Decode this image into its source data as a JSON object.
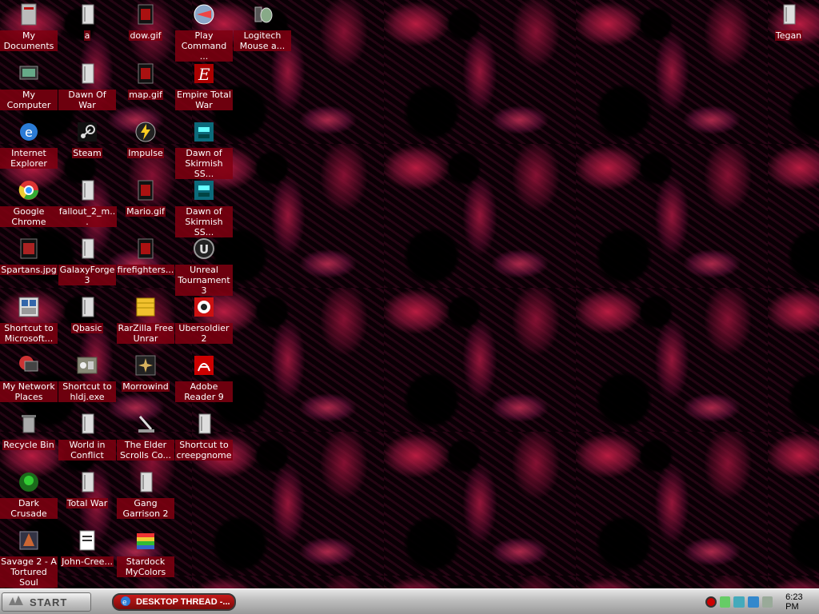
{
  "desktop": {
    "icons": [
      {
        "label": "My Documents",
        "icon": "folder-documents-icon"
      },
      {
        "label": "My Computer",
        "icon": "computer-icon"
      },
      {
        "label": "Internet Explorer",
        "icon": "ie-icon"
      },
      {
        "label": "Google Chrome",
        "icon": "chrome-icon"
      },
      {
        "label": "Spartans.jpg",
        "icon": "image-file-icon"
      },
      {
        "label": "Shortcut to Microsoft...",
        "icon": "app-shortcut-icon"
      },
      {
        "label": "My Network Places",
        "icon": "network-icon"
      },
      {
        "label": "Recycle Bin",
        "icon": "recycle-bin-icon"
      },
      {
        "label": "Dark Crusade",
        "icon": "game-icon"
      },
      {
        "label": "Savage 2 - A Tortured Soul",
        "icon": "game-icon"
      },
      {
        "label": "a",
        "icon": "folder-icon"
      },
      {
        "label": "Dawn Of War",
        "icon": "folder-icon"
      },
      {
        "label": "Steam",
        "icon": "steam-icon"
      },
      {
        "label": "fallout_2_m...",
        "icon": "folder-icon"
      },
      {
        "label": "GalaxyForge 3",
        "icon": "folder-icon"
      },
      {
        "label": "Qbasic",
        "icon": "folder-icon"
      },
      {
        "label": "Shortcut to hldj.exe",
        "icon": "app-shortcut-icon"
      },
      {
        "label": "World in Conflict",
        "icon": "folder-icon"
      },
      {
        "label": "Total War",
        "icon": "folder-icon"
      },
      {
        "label": "John-Cree...",
        "icon": "text-file-icon"
      },
      {
        "label": "dow.gif",
        "icon": "image-file-icon"
      },
      {
        "label": "map.gif",
        "icon": "image-file-icon"
      },
      {
        "label": "Impulse",
        "icon": "impulse-icon"
      },
      {
        "label": "Mario.gif",
        "icon": "image-file-icon"
      },
      {
        "label": "firefighters...",
        "icon": "image-file-icon"
      },
      {
        "label": "RarZilla Free Unrar",
        "icon": "archive-icon"
      },
      {
        "label": "Morrowind",
        "icon": "game-icon"
      },
      {
        "label": "The Elder Scrolls Co...",
        "icon": "tool-icon"
      },
      {
        "label": "Gang Garrison 2",
        "icon": "folder-icon"
      },
      {
        "label": "Stardock MyColors",
        "icon": "stardock-icon"
      },
      {
        "label": "Play Command ...",
        "icon": "game-icon"
      },
      {
        "label": "Empire Total War",
        "icon": "game-icon"
      },
      {
        "label": "Dawn of Skirmish SS...",
        "icon": "game-icon"
      },
      {
        "label": "Dawn of Skirmish SS...",
        "icon": "game-icon"
      },
      {
        "label": "Unreal Tournament 3",
        "icon": "game-icon"
      },
      {
        "label": "Ubersoldier 2",
        "icon": "game-icon"
      },
      {
        "label": "Adobe Reader 9",
        "icon": "pdf-icon"
      },
      {
        "label": "Shortcut to creepgnome",
        "icon": "folder-icon"
      },
      {
        "label": "Logitech Mouse a...",
        "icon": "mouse-icon"
      },
      {
        "label": "Tegan",
        "icon": "folder-icon"
      }
    ]
  },
  "taskbar": {
    "start_label": "START",
    "task_label": "DESKTOP THREAD -...",
    "clock": "6:23 PM"
  },
  "colors": {
    "label_bg": "#800010",
    "task_red": "#c81a1a"
  }
}
